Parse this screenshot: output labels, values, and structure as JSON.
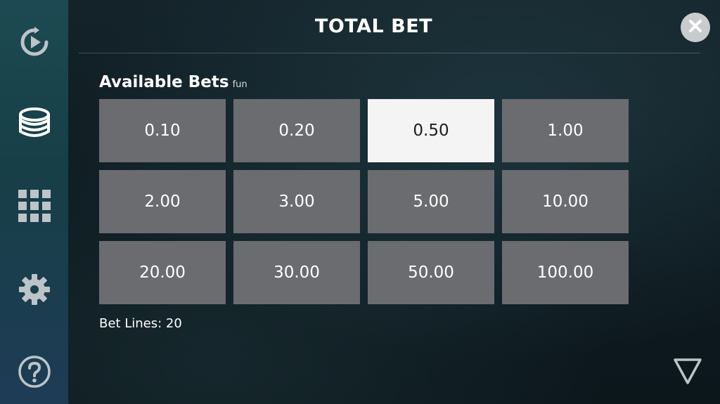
{
  "dialog": {
    "title": "TOTAL BET",
    "close_icon": "close-icon"
  },
  "sidebar": {
    "items": [
      {
        "name": "autoplay",
        "icon": "autoplay-icon"
      },
      {
        "name": "bet",
        "icon": "chips-icon",
        "active": true
      },
      {
        "name": "paytable",
        "icon": "grid-icon"
      },
      {
        "name": "settings",
        "icon": "gear-icon"
      },
      {
        "name": "help",
        "icon": "help-icon"
      }
    ]
  },
  "available_bets": {
    "title": "Available Bets",
    "mode": "fun",
    "selected": "0.50",
    "options": [
      "0.10",
      "0.20",
      "0.50",
      "1.00",
      "2.00",
      "3.00",
      "5.00",
      "10.00",
      "20.00",
      "30.00",
      "50.00",
      "100.00"
    ]
  },
  "bet_lines": {
    "label": "Bet Lines: 20"
  },
  "corner": {
    "icon": "shield-icon"
  },
  "colors": {
    "tile": "#6a6c6f",
    "tile_selected": "#f3f4f3",
    "sidebar_top": "#1d4a52",
    "sidebar_bottom": "#1e3c56",
    "icon": "#bcc4c7"
  }
}
